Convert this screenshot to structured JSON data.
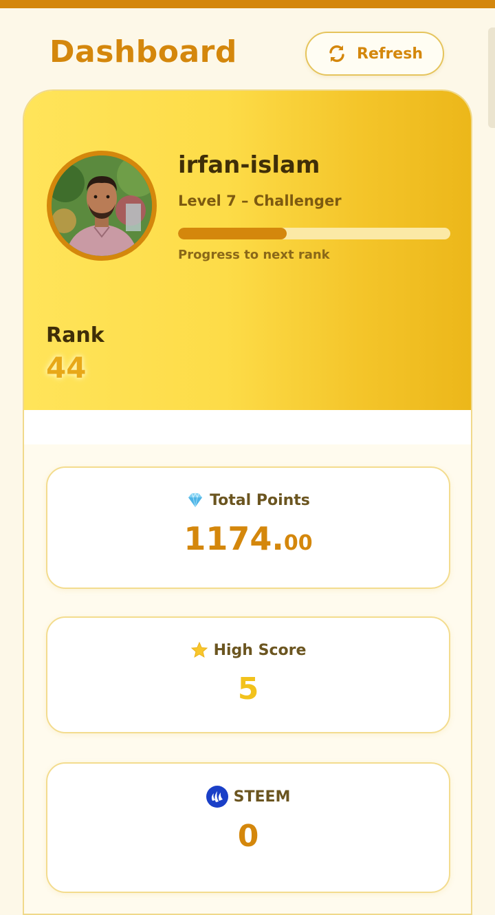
{
  "header": {
    "title": "Dashboard",
    "refresh_label": "Refresh"
  },
  "profile": {
    "username": "irfan-islam",
    "level": "Level 7 – Challenger",
    "progress_fraction": 0.4,
    "progress_label": "Progress to next rank",
    "rank_label": "Rank",
    "rank_value": "44"
  },
  "stats": {
    "total_points": {
      "icon": "diamond-icon",
      "label": "Total Points",
      "value_int": "1174.",
      "value_dec": "00"
    },
    "high_score": {
      "icon": "star-icon",
      "label": "High Score",
      "value": "5"
    },
    "steem": {
      "icon": "steem-logo-icon",
      "label": "STEEM",
      "value": "0"
    }
  },
  "colors": {
    "accent": "#d4870c",
    "hero_start": "#ffe45a",
    "hero_end": "#ecb71a",
    "high_score": "#f2c21c",
    "steem_blue": "#1a3fc7"
  }
}
